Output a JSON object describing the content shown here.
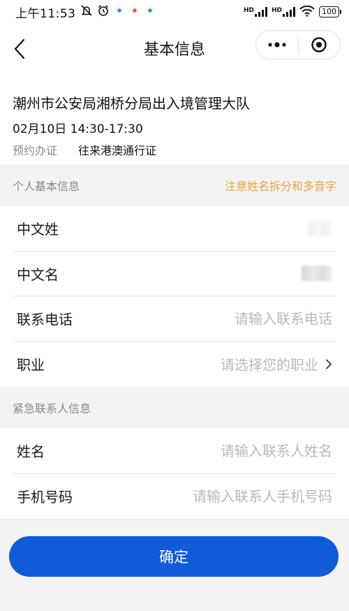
{
  "status_bar": {
    "time": "上午11:53",
    "network_labels": [
      "HD",
      "HD"
    ],
    "battery": "100"
  },
  "nav": {
    "title": "基本信息"
  },
  "appointment": {
    "office": "潮州市公安局湘桥分局出入境管理大队",
    "time": "02月10日 14:30-17:30",
    "type_label": "预约办证",
    "type_value": "往来港澳通行证"
  },
  "personal_section": {
    "title": "个人基本信息",
    "note": "注意姓名拆分和多音字",
    "rows": [
      {
        "label": "中文姓"
      },
      {
        "label": "中文名"
      },
      {
        "label": "联系电话",
        "placeholder": "请输入联系电话"
      },
      {
        "label": "职业",
        "placeholder": "请选择您的职业"
      }
    ]
  },
  "emergency_section": {
    "title": "紧急联系人信息",
    "rows": [
      {
        "label": "姓名",
        "placeholder": "请输入联系人姓名"
      },
      {
        "label": "手机号码",
        "placeholder": "请输入联系人手机号码"
      }
    ]
  },
  "confirm_label": "确定"
}
